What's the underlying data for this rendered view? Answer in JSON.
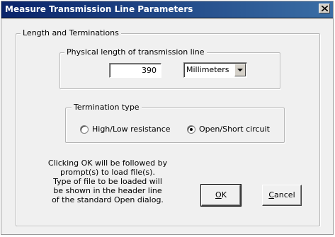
{
  "window": {
    "title": "Measure Transmission Line Parameters",
    "close_label": "×"
  },
  "group_length": {
    "legend": "Length and Terminations"
  },
  "group_physical": {
    "legend": "Physical length of transmission line",
    "length_value": "390",
    "units_selected": "Millimeters"
  },
  "group_termination": {
    "legend": "Termination type",
    "options": [
      {
        "label": "High/Low resistance",
        "selected": false
      },
      {
        "label": "Open/Short circuit",
        "selected": true
      }
    ]
  },
  "note": {
    "text": "Clicking OK will be followed by\nprompt(s) to load file(s).\nType of file to be loaded will\nbe shown in the header line\nof the standard Open dialog."
  },
  "buttons": {
    "ok_mnemonic": "O",
    "ok_rest": "K",
    "cancel_mnemonic": "C",
    "cancel_rest": "ancel"
  }
}
